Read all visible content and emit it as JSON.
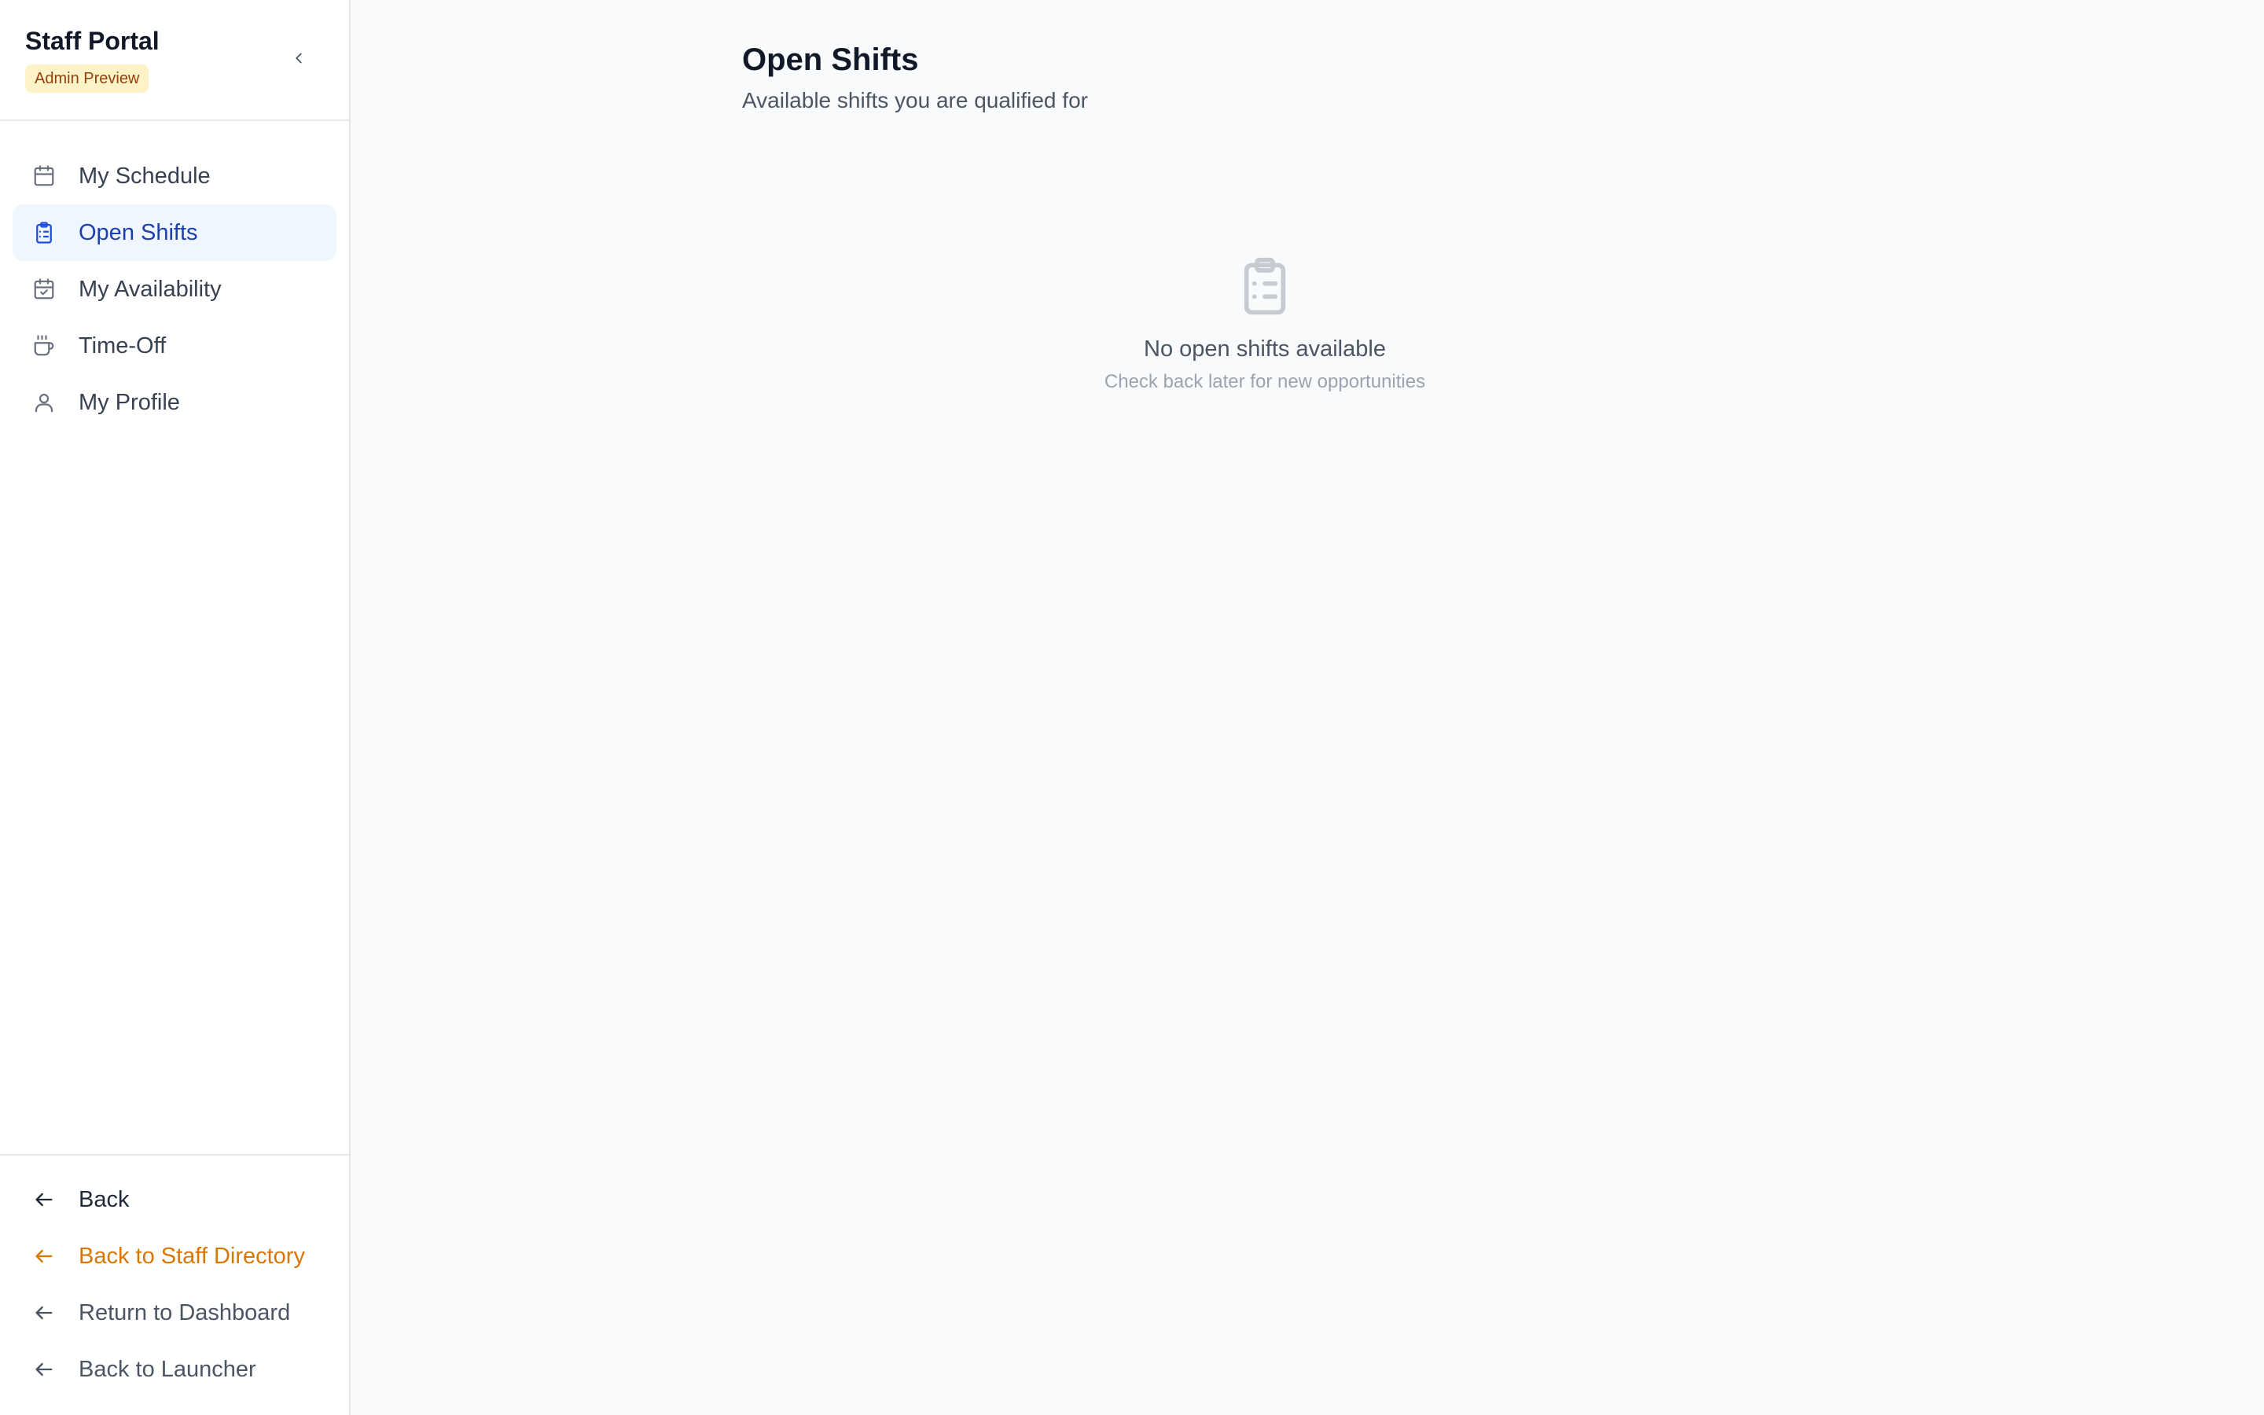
{
  "sidebar": {
    "title": "Staff Portal",
    "badge": "Admin Preview",
    "nav": [
      {
        "label": "My Schedule",
        "icon": "calendar-icon"
      },
      {
        "label": "Open Shifts",
        "icon": "clipboard-list-icon",
        "active": true
      },
      {
        "label": "My Availability",
        "icon": "calendar-check-icon"
      },
      {
        "label": "Time-Off",
        "icon": "coffee-icon"
      },
      {
        "label": "My Profile",
        "icon": "user-icon"
      }
    ],
    "footer": [
      {
        "label": "Back",
        "icon": "arrow-left-icon"
      },
      {
        "label": "Back to Staff Directory",
        "icon": "arrow-left-icon"
      },
      {
        "label": "Return to Dashboard",
        "icon": "arrow-left-icon"
      },
      {
        "label": "Back to Launcher",
        "icon": "arrow-left-icon"
      }
    ]
  },
  "main": {
    "title": "Open Shifts",
    "subtitle": "Available shifts you are qualified for",
    "empty": {
      "title": "No open shifts available",
      "subtitle": "Check back later for new opportunities"
    }
  },
  "colors": {
    "active_bg": "#eff6ff",
    "active_text": "#1e40af",
    "badge_bg": "#fef3c7",
    "badge_text": "#92400e",
    "orange_link": "#d97706"
  }
}
